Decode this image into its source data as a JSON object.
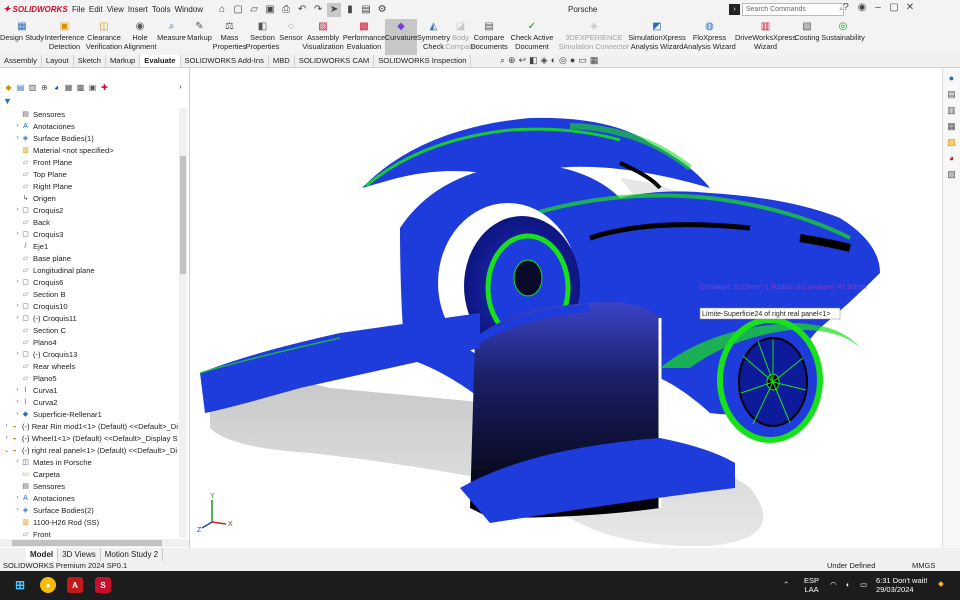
{
  "app": {
    "brand": "SOLIDWORKS",
    "document_title": "Porsche",
    "menus": [
      "File",
      "Edit",
      "View",
      "Insert",
      "Tools",
      "Window"
    ],
    "search_placeholder": "Search Commands"
  },
  "ribbon": [
    {
      "label": "Design Study",
      "icon": "design-study-icon"
    },
    {
      "label": "Interference Detection",
      "icon": "interference-icon"
    },
    {
      "label": "Clearance Verification",
      "icon": "clearance-icon"
    },
    {
      "label": "Hole Alignment",
      "icon": "hole-alignment-icon"
    },
    {
      "label": "Measure",
      "icon": "measure-icon"
    },
    {
      "label": "Markup",
      "icon": "markup-icon"
    },
    {
      "label": "Mass Properties",
      "icon": "mass-properties-icon"
    },
    {
      "label": "Section Properties",
      "icon": "section-properties-icon"
    },
    {
      "label": "Sensor",
      "icon": "sensor-icon"
    },
    {
      "label": "Assembly Visualization",
      "icon": "assembly-visualization-icon"
    },
    {
      "label": "Performance Evaluation",
      "icon": "performance-icon"
    },
    {
      "label": "Curvature",
      "icon": "curvature-icon",
      "active": true
    },
    {
      "label": "Symmetry Check",
      "icon": "symmetry-icon"
    },
    {
      "label": "Body Compare",
      "icon": "body-compare-icon",
      "disabled": true
    },
    {
      "label": "Compare Documents",
      "icon": "compare-documents-icon"
    },
    {
      "label": "Check Active Document",
      "icon": "check-document-icon"
    },
    {
      "label": "3DEXPERIENCE Simulation Connector",
      "icon": "3dexperience-icon",
      "disabled": true
    },
    {
      "label": "SimulationXpress Analysis Wizard",
      "icon": "simulationxpress-icon"
    },
    {
      "label": "FloXpress Analysis Wizard",
      "icon": "floxpress-icon"
    },
    {
      "label": "DriveWorksXpress Wizard",
      "icon": "driveworks-icon"
    },
    {
      "label": "Costing",
      "icon": "costing-icon"
    },
    {
      "label": "Sustainability",
      "icon": "sustainability-icon"
    }
  ],
  "tabs": [
    {
      "label": "Assembly"
    },
    {
      "label": "Layout"
    },
    {
      "label": "Sketch"
    },
    {
      "label": "Markup"
    },
    {
      "label": "Evaluate",
      "active": true
    },
    {
      "label": "SOLIDWORKS Add-Ins"
    },
    {
      "label": "MBD"
    },
    {
      "label": "SOLIDWORKS CAM"
    },
    {
      "label": "SOLIDWORKS Inspection"
    }
  ],
  "tree": [
    {
      "label": "Sensores",
      "icon": "sensor-folder-icon",
      "toggle": ""
    },
    {
      "label": "Anotaciones",
      "icon": "annotations-icon",
      "toggle": "›"
    },
    {
      "label": "Surface Bodies(1)",
      "icon": "surface-bodies-icon",
      "toggle": "›"
    },
    {
      "label": "Material <not specified>",
      "icon": "material-icon",
      "toggle": ""
    },
    {
      "label": "Front Plane",
      "icon": "plane-icon",
      "toggle": ""
    },
    {
      "label": "Top Plane",
      "icon": "plane-icon",
      "toggle": ""
    },
    {
      "label": "Right Plane",
      "icon": "plane-icon",
      "toggle": ""
    },
    {
      "label": "Origen",
      "icon": "origin-icon",
      "toggle": ""
    },
    {
      "label": "Croquis2",
      "icon": "sketch-icon",
      "toggle": "›"
    },
    {
      "label": "Back",
      "icon": "plane-icon",
      "toggle": ""
    },
    {
      "label": "Croquis3",
      "icon": "sketch-icon",
      "toggle": "›"
    },
    {
      "label": "Eje1",
      "icon": "axis-icon",
      "toggle": ""
    },
    {
      "label": "Base plane",
      "icon": "plane-icon",
      "toggle": ""
    },
    {
      "label": "Longitudinal plane",
      "icon": "plane-icon",
      "toggle": ""
    },
    {
      "label": "Croquis6",
      "icon": "sketch-icon",
      "toggle": "›"
    },
    {
      "label": "Section B",
      "icon": "plane-icon",
      "toggle": ""
    },
    {
      "label": "Croquis10",
      "icon": "sketch-icon",
      "toggle": "›"
    },
    {
      "label": "(-) Croquis11",
      "icon": "sketch-icon",
      "toggle": "›"
    },
    {
      "label": "Section C",
      "icon": "plane-icon",
      "toggle": ""
    },
    {
      "label": "Plano4",
      "icon": "plane-icon",
      "toggle": ""
    },
    {
      "label": "(-) Croquis13",
      "icon": "sketch-icon",
      "toggle": "›"
    },
    {
      "label": "Rear wheels",
      "icon": "plane-icon",
      "toggle": ""
    },
    {
      "label": "Plano5",
      "icon": "plane-icon",
      "toggle": ""
    },
    {
      "label": "Curva1",
      "icon": "curve-icon",
      "toggle": "›"
    },
    {
      "label": "Curva2",
      "icon": "curve-icon",
      "toggle": "›"
    },
    {
      "label": "Superficie-Rellenar1",
      "icon": "fill-surface-icon",
      "toggle": "›"
    },
    {
      "label": "(-) Rear Rin mod1<1> (Default) <<Default>_Di",
      "icon": "part-icon",
      "toggle": "›",
      "level": 0
    },
    {
      "label": "(-) Wheel1<1> (Default) <<Default>_Display S",
      "icon": "part-icon",
      "toggle": "›",
      "level": 0
    },
    {
      "label": "(-) right real panel<1> (Default) <<Default>_Di",
      "icon": "part-icon",
      "toggle": "⌄",
      "level": 0
    },
    {
      "label": "Mates in Porsche",
      "icon": "mates-icon",
      "toggle": "›"
    },
    {
      "label": "Carpeta",
      "icon": "folder-icon",
      "toggle": ""
    },
    {
      "label": "Sensores",
      "icon": "sensor-folder-icon",
      "toggle": ""
    },
    {
      "label": "Anotaciones",
      "icon": "annotations-icon",
      "toggle": "›"
    },
    {
      "label": "Surface Bodies(2)",
      "icon": "surface-bodies-icon",
      "toggle": "›"
    },
    {
      "label": "1100-H26 Rod (SS)",
      "icon": "material-icon",
      "toggle": ""
    },
    {
      "label": "Front",
      "icon": "plane-icon",
      "toggle": ""
    }
  ],
  "viewport": {
    "curvature_readout": "Curvature: 0.02mm^-1 Radius of Curvature: 47.90mm",
    "tooltip": "Límite-Superficie24 of right real panel<1>",
    "triad": {
      "x": "X",
      "y": "Y",
      "z": "Z"
    }
  },
  "bottom_tabs": [
    {
      "label": "Model",
      "active": true
    },
    {
      "label": "3D Views"
    },
    {
      "label": "Motion Study 2"
    }
  ],
  "status": {
    "product": "SOLIDWORKS Premium 2024 SP0.1",
    "state": "Under Defined",
    "units": "MMGS"
  },
  "taskbar": {
    "lang_top": "ESP",
    "lang_bottom": "LAA",
    "time": "6:31",
    "notice": "Don't wait!",
    "date": "29/03/2024"
  },
  "colors": {
    "surface_blue": "#1e3cdc",
    "curvature_green": "#19e01c",
    "brand_red": "#c8102e"
  }
}
